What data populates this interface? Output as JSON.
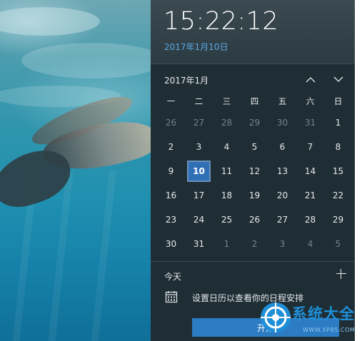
{
  "clock": {
    "time": "15:22:12",
    "date": "2017年1月10日"
  },
  "calendar": {
    "month_label": "2017年1月",
    "prev_icon": "chevron-up-icon",
    "next_icon": "chevron-down-icon",
    "weekdays": [
      "一",
      "二",
      "三",
      "四",
      "五",
      "六",
      "日"
    ],
    "days": [
      {
        "label": "26",
        "other": true
      },
      {
        "label": "27",
        "other": true
      },
      {
        "label": "28",
        "other": true
      },
      {
        "label": "29",
        "other": true
      },
      {
        "label": "30",
        "other": true
      },
      {
        "label": "31",
        "other": true
      },
      {
        "label": "1"
      },
      {
        "label": "2"
      },
      {
        "label": "3"
      },
      {
        "label": "4"
      },
      {
        "label": "5"
      },
      {
        "label": "6"
      },
      {
        "label": "7"
      },
      {
        "label": "8"
      },
      {
        "label": "9"
      },
      {
        "label": "10",
        "today": true
      },
      {
        "label": "11"
      },
      {
        "label": "12"
      },
      {
        "label": "13"
      },
      {
        "label": "14"
      },
      {
        "label": "15"
      },
      {
        "label": "16"
      },
      {
        "label": "17"
      },
      {
        "label": "18"
      },
      {
        "label": "19"
      },
      {
        "label": "20"
      },
      {
        "label": "21"
      },
      {
        "label": "22"
      },
      {
        "label": "23"
      },
      {
        "label": "24"
      },
      {
        "label": "25"
      },
      {
        "label": "26"
      },
      {
        "label": "27"
      },
      {
        "label": "28"
      },
      {
        "label": "29"
      },
      {
        "label": "30"
      },
      {
        "label": "31"
      },
      {
        "label": "1",
        "other": true
      },
      {
        "label": "2",
        "other": true
      },
      {
        "label": "3",
        "other": true
      },
      {
        "label": "4",
        "other": true
      },
      {
        "label": "5",
        "other": true
      }
    ]
  },
  "agenda": {
    "heading": "今天",
    "add_icon": "plus-icon",
    "calendar_icon": "calendar-icon",
    "prompt": "设置日历以查看你的日程安排",
    "start_button": "开始"
  },
  "watermark": {
    "text": "系统大全",
    "url": "WWW.XP85.COM"
  },
  "colors": {
    "flyout_bg": "#1f2e35",
    "accent": "#2c7cc4",
    "date_link": "#5aa8e8",
    "today_highlight": "#2f6fb5"
  }
}
